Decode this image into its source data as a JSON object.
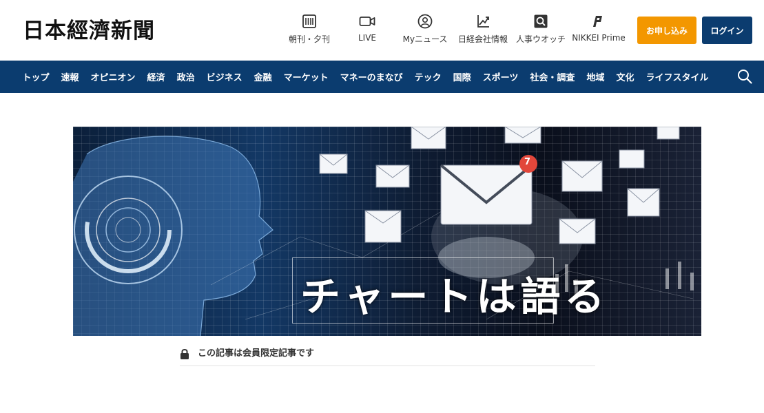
{
  "header": {
    "logo": "日本經濟新聞",
    "utilities": [
      {
        "label": "朝刊・夕刊",
        "icon": "newspaper-icon"
      },
      {
        "label": "LIVE",
        "icon": "video-camera-icon"
      },
      {
        "label": "Myニュース",
        "icon": "user-circle-icon"
      },
      {
        "label": "日経会社情報",
        "icon": "chart-trend-icon"
      },
      {
        "label": "人事ウオッチ",
        "icon": "search-person-icon"
      },
      {
        "label": "NIKKEI Prime",
        "icon": "prime-logo-icon"
      }
    ],
    "subscribe_label": "お申し込み",
    "login_label": "ログイン",
    "colors": {
      "subscribe": "#f39700",
      "brand_navy": "#0b3c6f"
    }
  },
  "nav": {
    "items": [
      "トップ",
      "速報",
      "オピニオン",
      "経済",
      "政治",
      "ビジネス",
      "金融",
      "マーケット",
      "マネーのまなび",
      "テック",
      "国際",
      "スポーツ",
      "社会・調査",
      "地域",
      "文化",
      "ライフスタイル"
    ],
    "search_icon": "search-icon"
  },
  "banner": {
    "title": "チャートは語る",
    "badge_count": "7"
  },
  "notice": {
    "text": "この記事は会員限定記事です",
    "icon": "lock-icon"
  }
}
